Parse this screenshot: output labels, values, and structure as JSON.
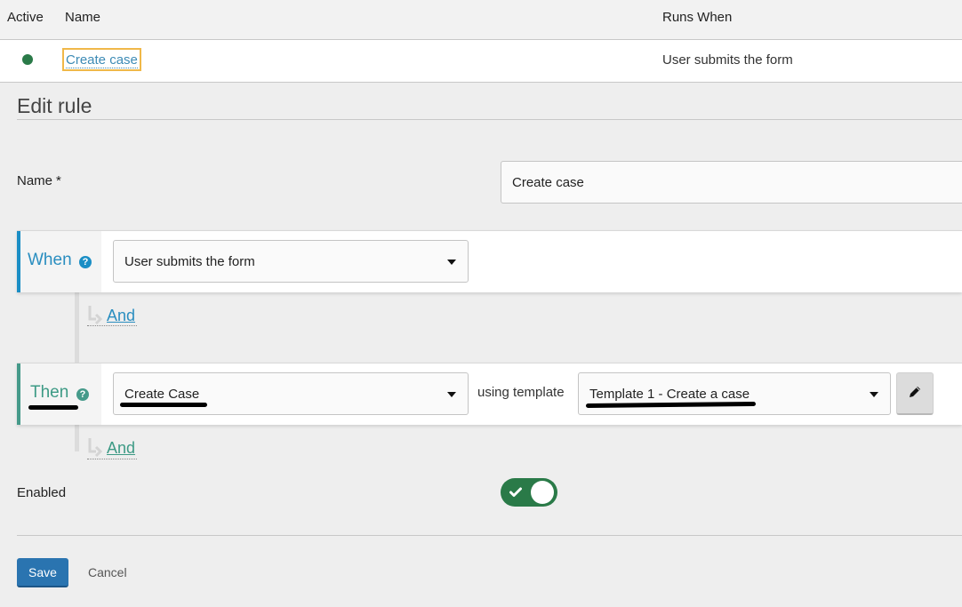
{
  "table": {
    "headers": {
      "active": "Active",
      "name": "Name",
      "runs_when": "Runs When"
    },
    "rows": [
      {
        "active": true,
        "name": "Create case",
        "runs_when": "User submits the form"
      }
    ]
  },
  "editor": {
    "title": "Edit rule",
    "name_label": "Name",
    "required_marker": "*",
    "name_value": "Create case",
    "when": {
      "label": "When",
      "help_icon": "question-circle-icon",
      "trigger_value": "User submits the form",
      "and_label": "And"
    },
    "then": {
      "label": "Then",
      "help_icon": "question-circle-icon",
      "action_value": "Create Case",
      "using_label": "using template",
      "template_value": "Template 1 - Create a case",
      "edit_icon": "pencil-icon",
      "and_label": "And"
    },
    "enabled_label": "Enabled",
    "enabled": true
  },
  "actions": {
    "save_label": "Save",
    "cancel_label": "Cancel"
  },
  "colors": {
    "active_green": "#2a7a48",
    "when_accent": "#1a8ec5",
    "then_accent": "#459a8a",
    "link_blue": "#3d8bb5",
    "focus_outline": "#f0b849",
    "primary_button": "#2a74b0"
  }
}
